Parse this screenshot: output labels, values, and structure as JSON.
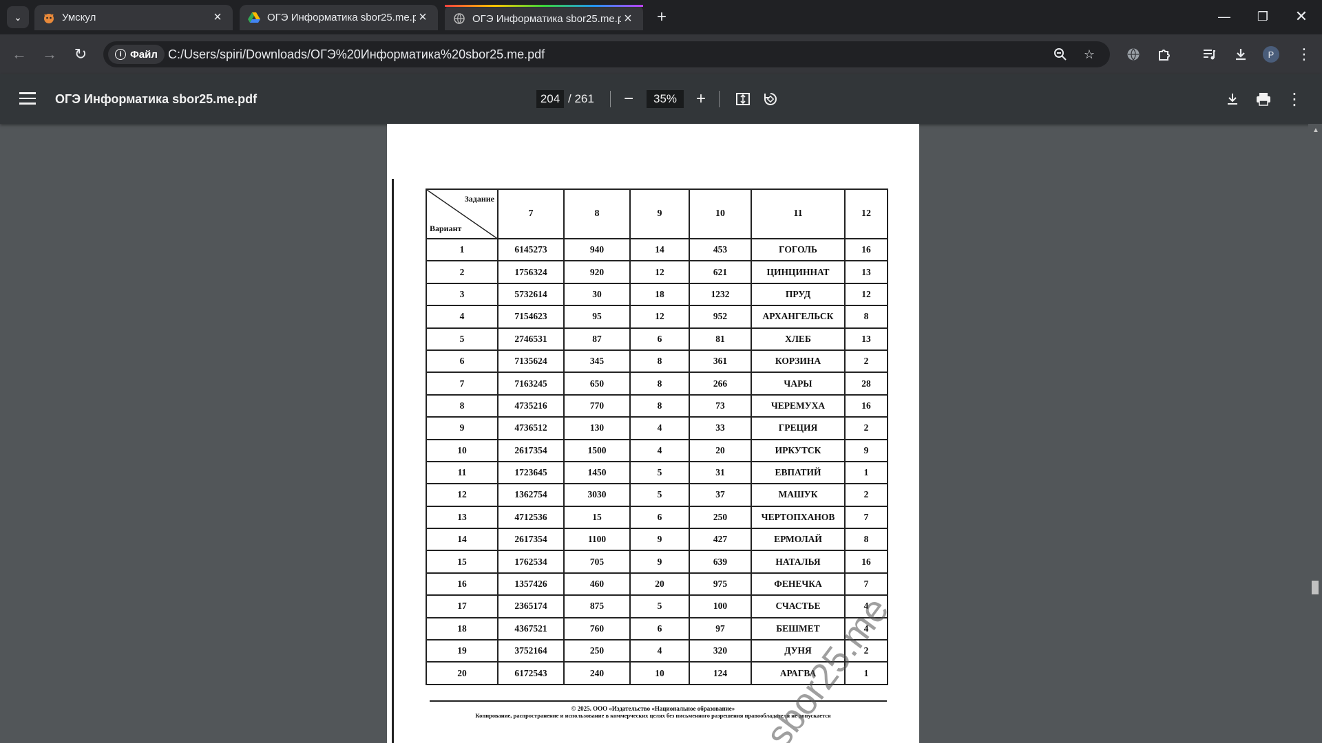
{
  "browser": {
    "tabs": [
      {
        "title": "Умскул",
        "favicon": "umskul-icon",
        "active": false
      },
      {
        "title": "ОГЭ Информатика sbor25.me.pdf",
        "favicon": "google-drive-icon",
        "active": false
      },
      {
        "title": "ОГЭ Информатика sbor25.me.pdf",
        "favicon": "globe-icon",
        "active": true
      }
    ],
    "address_chip": "Файл",
    "url": "C:/Users/spiri/Downloads/ОГЭ%20Информатика%20sbor25.me.pdf",
    "profile_initial": "P"
  },
  "pdf": {
    "title": "ОГЭ Информатика sbor25.me.pdf",
    "current_page": "204",
    "total_pages": "/ 261",
    "zoom": "35%"
  },
  "table": {
    "corner_top": "Задание",
    "corner_bottom": "Вариант",
    "columns": [
      "7",
      "8",
      "9",
      "10",
      "11",
      "12"
    ],
    "rows": [
      [
        "1",
        "6145273",
        "940",
        "14",
        "453",
        "ГОГОЛЬ",
        "16"
      ],
      [
        "2",
        "1756324",
        "920",
        "12",
        "621",
        "ЦИНЦИННАТ",
        "13"
      ],
      [
        "3",
        "5732614",
        "30",
        "18",
        "1232",
        "ПРУД",
        "12"
      ],
      [
        "4",
        "7154623",
        "95",
        "12",
        "952",
        "АРХАНГЕЛЬСК",
        "8"
      ],
      [
        "5",
        "2746531",
        "87",
        "6",
        "81",
        "ХЛЕБ",
        "13"
      ],
      [
        "6",
        "7135624",
        "345",
        "8",
        "361",
        "КОРЗИНА",
        "2"
      ],
      [
        "7",
        "7163245",
        "650",
        "8",
        "266",
        "ЧАРЫ",
        "28"
      ],
      [
        "8",
        "4735216",
        "770",
        "8",
        "73",
        "ЧЕРЕМУХА",
        "16"
      ],
      [
        "9",
        "4736512",
        "130",
        "4",
        "33",
        "ГРЕЦИЯ",
        "2"
      ],
      [
        "10",
        "2617354",
        "1500",
        "4",
        "20",
        "ИРКУТСК",
        "9"
      ],
      [
        "11",
        "1723645",
        "1450",
        "5",
        "31",
        "ЕВПАТИЙ",
        "1"
      ],
      [
        "12",
        "1362754",
        "3030",
        "5",
        "37",
        "МАШУК",
        "2"
      ],
      [
        "13",
        "4712536",
        "15",
        "6",
        "250",
        "ЧЕРТОПХАНОВ",
        "7"
      ],
      [
        "14",
        "2617354",
        "1100",
        "9",
        "427",
        "ЕРМОЛАЙ",
        "8"
      ],
      [
        "15",
        "1762534",
        "705",
        "9",
        "639",
        "НАТАЛЬЯ",
        "16"
      ],
      [
        "16",
        "1357426",
        "460",
        "20",
        "975",
        "ФЕНЕЧКА",
        "7"
      ],
      [
        "17",
        "2365174",
        "875",
        "5",
        "100",
        "СЧАСТЬЕ",
        "4"
      ],
      [
        "18",
        "4367521",
        "760",
        "6",
        "97",
        "БЕШМЕТ",
        "4"
      ],
      [
        "19",
        "3752164",
        "250",
        "4",
        "320",
        "ДУНЯ",
        "2"
      ],
      [
        "20",
        "6172543",
        "240",
        "10",
        "124",
        "АРАГВА",
        "1"
      ]
    ]
  },
  "footer": {
    "line1": "© 2025. ООО «Издательство «Национальное образование»",
    "line2": "Копирование, распространение и использование в коммерческих целях без письменного разрешения правообладателя не допускается"
  },
  "watermark": "sbor25.me"
}
